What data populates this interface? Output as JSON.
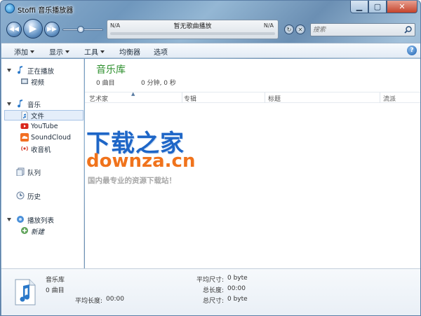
{
  "window": {
    "title": "Stoffi 音乐播放器",
    "buttons": [
      "▁",
      "▢",
      "✕"
    ]
  },
  "player": {
    "prev_icon": "previous-icon",
    "play_icon": "play-icon",
    "next_icon": "next-icon",
    "volume_level": 0.45,
    "now_playing": {
      "left": "N/A",
      "title": "暂无歌曲播放",
      "right": "N/A",
      "progress": 0
    },
    "search_placeholder": "搜索"
  },
  "menubar": {
    "items": [
      {
        "label": "添加",
        "dropdown": true
      },
      {
        "label": "显示",
        "dropdown": true
      },
      {
        "label": "工具",
        "dropdown": true
      },
      {
        "label": "均衡器",
        "dropdown": false
      },
      {
        "label": "选项",
        "dropdown": false
      }
    ],
    "help_label": "?"
  },
  "sidebar": {
    "groups": [
      {
        "label": "正在播放",
        "children": [
          {
            "label": "视频"
          }
        ]
      },
      {
        "label": "音乐",
        "children": [
          {
            "label": "文件",
            "selected": true
          },
          {
            "label": "YouTube"
          },
          {
            "label": "SoundCloud"
          },
          {
            "label": "收音机"
          }
        ]
      },
      {
        "label": "队列"
      },
      {
        "label": "历史"
      },
      {
        "label": "播放列表",
        "children": [
          {
            "label": "新建"
          }
        ]
      }
    ]
  },
  "main": {
    "title": "音乐库",
    "track_count": "0 曲目",
    "duration": "0 分钟, 0 秒",
    "columns": [
      "艺术家",
      "专辑",
      "标题",
      "流派"
    ],
    "watermark": {
      "line1": "下载之家",
      "line2": "downza.cn",
      "line3": "国内最专业的资源下载站！"
    }
  },
  "status": {
    "name": "音乐库",
    "count": "0 曲目",
    "avg_length_label": "平均长度:",
    "avg_length_value": "00:00",
    "avg_size_label": "平均尺寸:",
    "avg_size_value": "0 byte",
    "total_length_label": "总长度:",
    "total_length_value": "00:00",
    "total_size_label": "总尺寸:",
    "total_size_value": "0 byte"
  },
  "colors": {
    "accent_green": "#2c8f2c",
    "watermark_blue": "#1e66c7",
    "watermark_orange": "#f0731c"
  }
}
